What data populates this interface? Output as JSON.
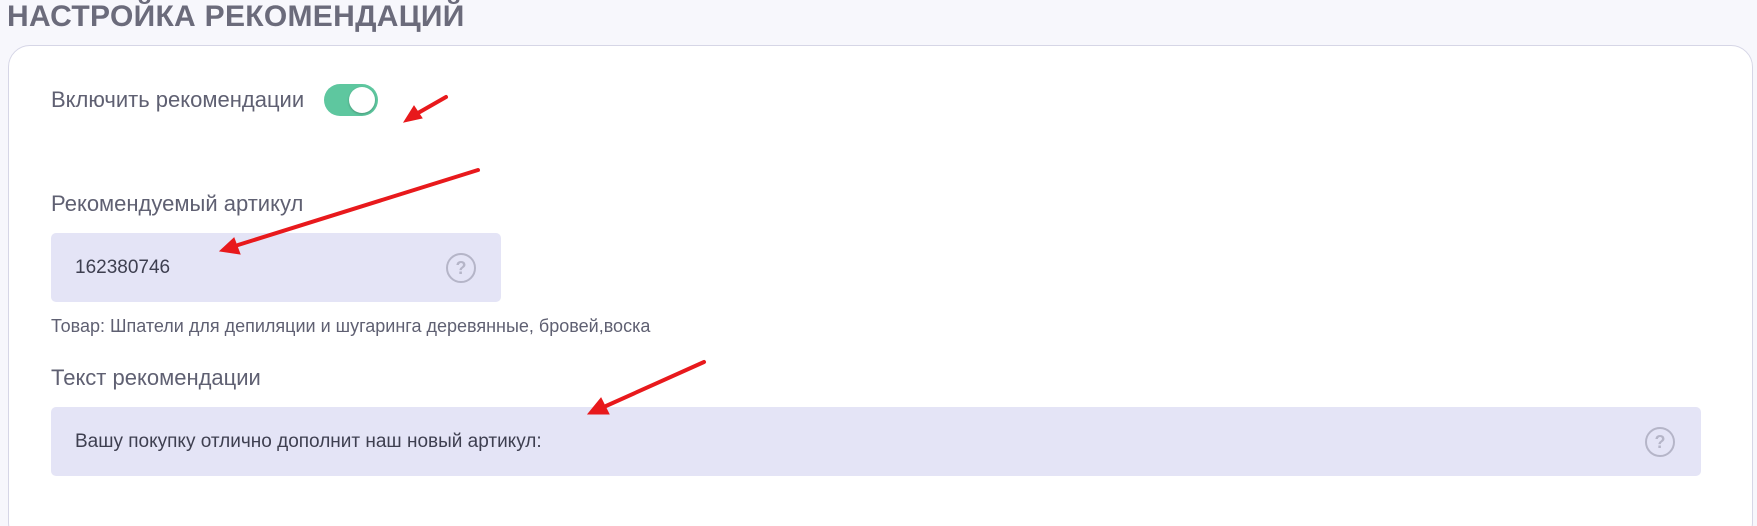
{
  "section": {
    "title": "НАСТРОЙКА РЕКОМЕНДАЦИЙ"
  },
  "toggle": {
    "label": "Включить рекомендации",
    "state": "on",
    "color": "#5ec79f"
  },
  "article_field": {
    "label": "Рекомендуемый артикул",
    "value": "162380746",
    "help_icon": "question-circle-icon"
  },
  "product_note": "Товар: Шпатели для депиляции и шугаринга деревянные, бровей,воска",
  "text_field": {
    "label": "Текст рекомендации",
    "value": "Вашу покупку отлично дополнит наш новый артикул:",
    "help_icon": "question-circle-icon"
  },
  "colors": {
    "annotation_arrow": "#e8191c",
    "input_bg": "#e4e4f6",
    "text": "#5f6072"
  }
}
